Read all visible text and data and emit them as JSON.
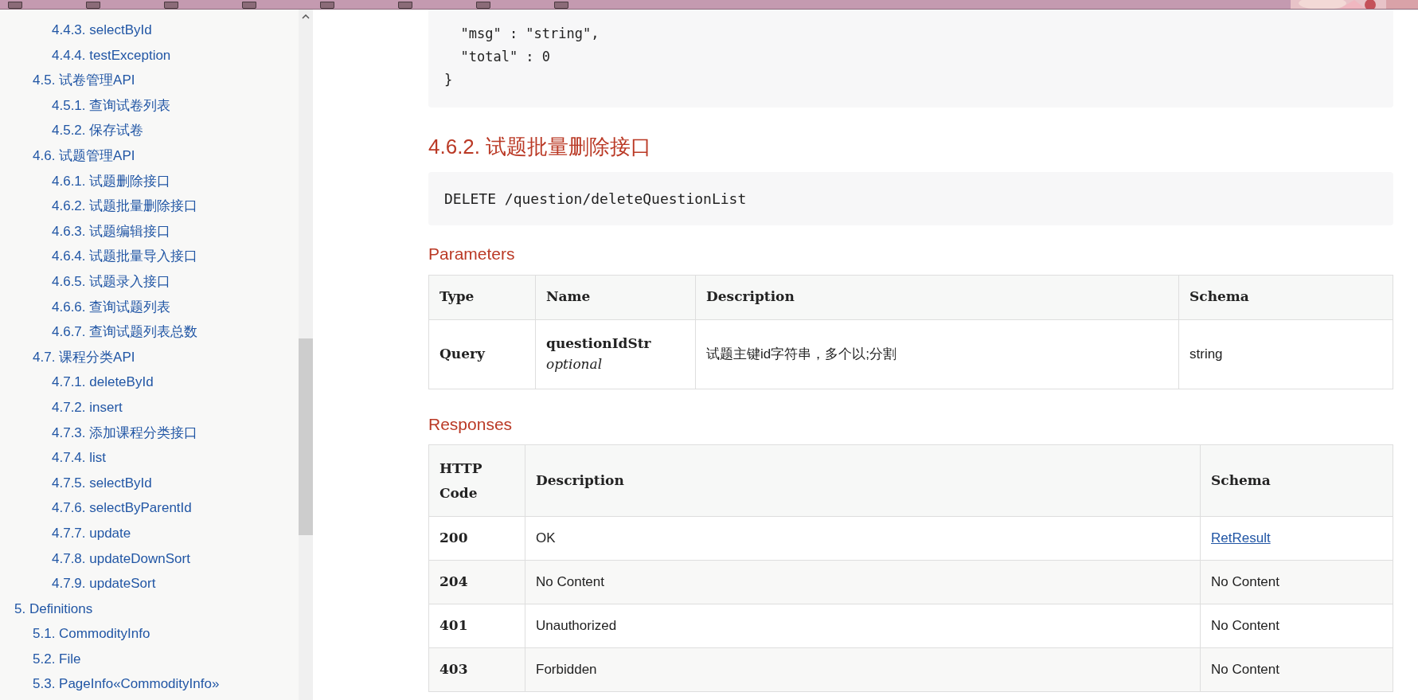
{
  "toc": [
    {
      "children": [
        {
          "children": [
            {
              "label": "4.4.3. selectById"
            },
            {
              "label": "4.4.4. testException"
            }
          ]
        },
        {
          "label": "4.5. 试卷管理API",
          "children": [
            {
              "label": "4.5.1. 查询试卷列表"
            },
            {
              "label": "4.5.2. 保存试卷"
            }
          ]
        },
        {
          "label": "4.6. 试题管理API",
          "children": [
            {
              "label": "4.6.1. 试题删除接口"
            },
            {
              "label": "4.6.2. 试题批量删除接口"
            },
            {
              "label": "4.6.3. 试题编辑接口"
            },
            {
              "label": "4.6.4. 试题批量导入接口"
            },
            {
              "label": "4.6.5. 试题录入接口"
            },
            {
              "label": "4.6.6. 查询试题列表"
            },
            {
              "label": "4.6.7. 查询试题列表总数"
            }
          ]
        },
        {
          "label": "4.7. 课程分类API",
          "children": [
            {
              "label": "4.7.1. deleteById"
            },
            {
              "label": "4.7.2. insert"
            },
            {
              "label": "4.7.3. 添加课程分类接口"
            },
            {
              "label": "4.7.4. list"
            },
            {
              "label": "4.7.5. selectById"
            },
            {
              "label": "4.7.6. selectByParentId"
            },
            {
              "label": "4.7.7. update"
            },
            {
              "label": "4.7.8. updateDownSort"
            },
            {
              "label": "4.7.9. updateSort"
            }
          ]
        }
      ]
    },
    {
      "label": "5. Definitions",
      "children": [
        {
          "label": "5.1. CommodityInfo"
        },
        {
          "label": "5.2. File"
        },
        {
          "label": "5.3. PageInfo«CommodityInfo»"
        }
      ]
    }
  ],
  "code_lines": [
    "  \"msg\" : \"string\",",
    "  \"total\" : 0",
    "}"
  ],
  "heading": "4.6.2. 试题批量删除接口",
  "endpoint": "DELETE /question/deleteQuestionList",
  "parameters": {
    "title": "Parameters",
    "columns": [
      "Type",
      "Name",
      "Description",
      "Schema"
    ],
    "rows": [
      {
        "type": "Query",
        "name": "questionIdStr",
        "note": "optional",
        "description": "试题主键id字符串，多个以;分割",
        "schema": "string"
      }
    ]
  },
  "responses": {
    "title": "Responses",
    "columns": [
      "HTTP Code",
      "Description",
      "Schema"
    ],
    "rows": [
      {
        "code": "200",
        "description": "OK",
        "schema": "RetResult",
        "link": true
      },
      {
        "code": "204",
        "description": "No Content",
        "schema": "No Content",
        "link": false
      },
      {
        "code": "401",
        "description": "Unauthorized",
        "schema": "No Content",
        "link": false
      },
      {
        "code": "403",
        "description": "Forbidden",
        "schema": "No Content",
        "link": false
      }
    ]
  }
}
